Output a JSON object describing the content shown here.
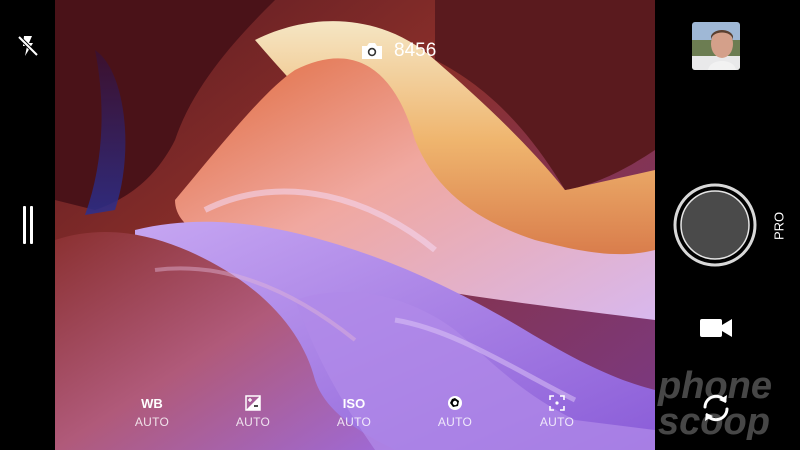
{
  "top_bar": {
    "flash_icon": "flash-off-icon",
    "shot_counter": "8456",
    "counter_icon": "camera-icon"
  },
  "side_panel": {
    "drawer_icon": "drawer-handle-icon"
  },
  "right_panel": {
    "gallery_thumbnail": "gallery-thumbnail",
    "shutter_icon": "shutter-button",
    "mode_label": "PRO",
    "video_icon": "video-camera-icon",
    "switch_icon": "switch-camera-icon"
  },
  "settings": [
    {
      "label": "WB",
      "value": "AUTO",
      "icon": "wb-text"
    },
    {
      "label": "",
      "value": "AUTO",
      "icon": "exposure-icon"
    },
    {
      "label": "ISO",
      "value": "AUTO",
      "icon": "iso-text"
    },
    {
      "label": "",
      "value": "AUTO",
      "icon": "aperture-icon"
    },
    {
      "label": "",
      "value": "AUTO",
      "icon": "focus-icon"
    }
  ],
  "watermark": {
    "text_line1": "phone",
    "text_line2": "scoop"
  },
  "colors": {
    "shutter_fill": "#4a4a4a",
    "background": "#000000",
    "text": "#ffffff"
  }
}
